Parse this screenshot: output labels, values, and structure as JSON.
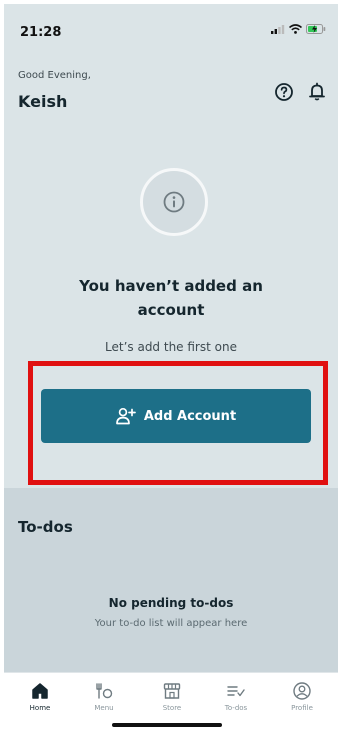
{
  "status": {
    "time": "21:28"
  },
  "header": {
    "greeting": "Good Evening,",
    "user_name": "Keish"
  },
  "empty_state": {
    "title_line1": "You haven’t added an",
    "title_line2": "account",
    "subtitle": "Let’s add the first one",
    "button_label": "Add Account"
  },
  "todos": {
    "title": "To-dos",
    "empty_title": "No pending to-dos",
    "empty_subtitle": "Your to-do list will appear here"
  },
  "tabs": [
    {
      "label": "Home",
      "icon": "home-icon",
      "active": true
    },
    {
      "label": "Menu",
      "icon": "menu-icon",
      "active": false
    },
    {
      "label": "Store",
      "icon": "store-icon",
      "active": false
    },
    {
      "label": "To-dos",
      "icon": "todos-icon",
      "active": false
    },
    {
      "label": "Profile",
      "icon": "profile-icon",
      "active": false
    }
  ],
  "colors": {
    "accent": "#1d6f88",
    "highlight": "#e01010",
    "background": "#dbe4e7",
    "todos_bg": "#cad5da"
  }
}
